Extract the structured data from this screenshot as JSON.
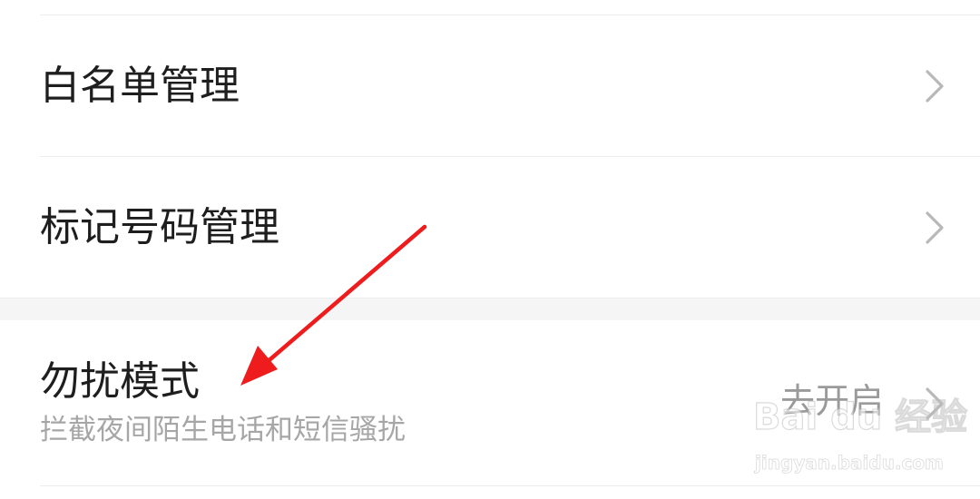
{
  "rows": [
    {
      "title": "白名单管理",
      "chevron_icon": "chevron-right-icon"
    },
    {
      "title": "标记号码管理",
      "chevron_icon": "chevron-right-icon"
    },
    {
      "title": "勿扰模式",
      "subtitle": "拦截夜间陌生电话和短信骚扰",
      "value": "去开启",
      "chevron_icon": "chevron-right-icon"
    }
  ],
  "watermark": {
    "main": "Bai du 经验",
    "sub": "jingyan.baidu.com"
  },
  "colors": {
    "title": "#1e1e1e",
    "subtitle": "#a6a6a6",
    "value": "#9a9a9a",
    "chevron": "#b8b8b8",
    "divider": "#ececec",
    "section_gap": "#f5f5f5",
    "annotation_arrow": "#ee1c1c"
  }
}
